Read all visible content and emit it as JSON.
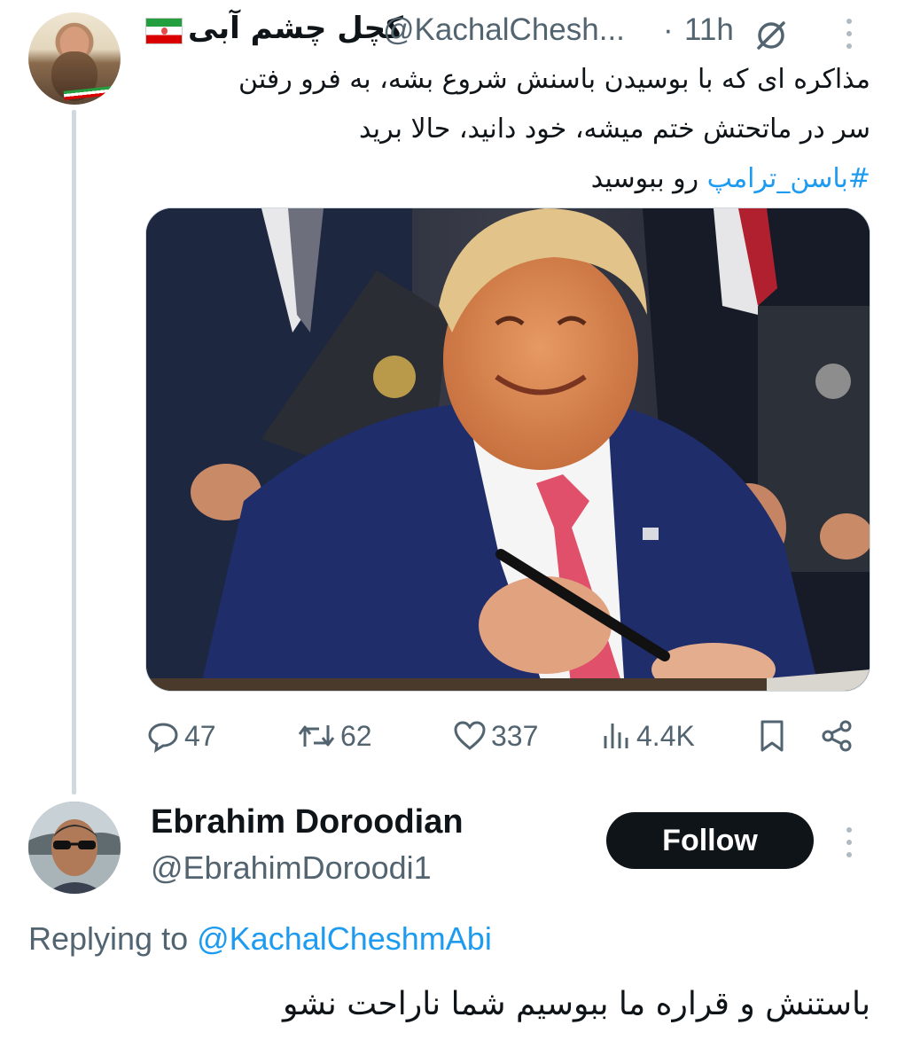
{
  "parent_tweet": {
    "display_name": "کچل چشم آبی",
    "flag_emoji": "iran-flag",
    "handle": "@KachalChesh...",
    "separator": "·",
    "time": "11h",
    "text_lines": [
      "مذاکره ای که با بوسیدن باسنش شروع بشه، به فرو رفتن",
      "سر در ماتحتش ختم میشه، خود دانید، حالا برید"
    ],
    "hashtag": "#باسن_ترامپ",
    "text_tail": "رو ببوسید",
    "stats": {
      "replies": "47",
      "reposts": "62",
      "likes": "337",
      "views": "4.4K"
    }
  },
  "reply": {
    "author_name": "Ebrahim Doroodian",
    "handle": "@EbrahimDoroodi1",
    "follow_label": "Follow",
    "replying_prefix": "Replying to",
    "replying_to": "@KachalCheshmAbi",
    "text": "باستنش و قراره ما ببوسیم شما ناراحت نشو"
  },
  "colors": {
    "link": "#1d9bf0",
    "muted": "#536471",
    "text": "#0f1419",
    "thread_line": "#cfd9de"
  }
}
